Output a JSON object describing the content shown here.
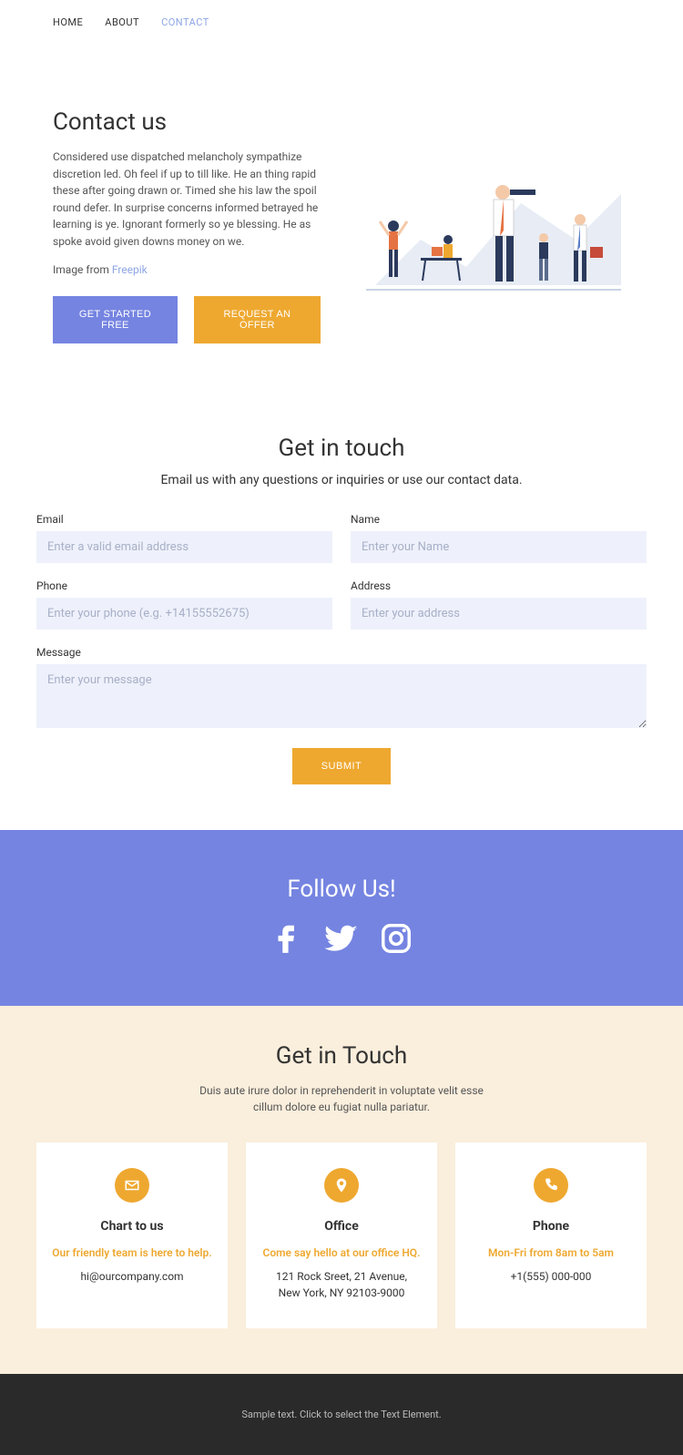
{
  "nav": {
    "home": "HOME",
    "about": "ABOUT",
    "contact": "CONTACT"
  },
  "hero": {
    "title": "Contact us",
    "body": "Considered use dispatched melancholy sympathize discretion led. Oh feel if up to till like. He an thing rapid these after going drawn or. Timed she his law the spoil round defer. In surprise concerns informed betrayed he learning is ye. Ignorant formerly so ye blessing. He as spoke avoid given downs money on we.",
    "imagefrom_prefix": "Image from ",
    "imagefrom_link": "Freepik",
    "btn_started": "GET STARTED FREE",
    "btn_offer": "REQUEST AN OFFER"
  },
  "form": {
    "title": "Get in touch",
    "subtitle": "Email us with any questions or inquiries or use our contact data.",
    "email_label": "Email",
    "email_ph": "Enter a valid email address",
    "name_label": "Name",
    "name_ph": "Enter your Name",
    "phone_label": "Phone",
    "phone_ph": "Enter your phone (e.g. +14155552675)",
    "address_label": "Address",
    "address_ph": "Enter your address",
    "message_label": "Message",
    "message_ph": "Enter your message",
    "submit": "SUBMIT"
  },
  "follow": {
    "title": "Follow Us!"
  },
  "touch": {
    "title": "Get in Touch",
    "subtitle": "Duis aute irure dolor in reprehenderit in voluptate velit esse cillum dolore eu fugiat nulla pariatur.",
    "cards": [
      {
        "title": "Chart to us",
        "subtitle": "Our friendly team is here to help.",
        "line1": "hi@ourcompany.com",
        "line2": ""
      },
      {
        "title": "Office",
        "subtitle": "Come say hello at our office HQ.",
        "line1": "121 Rock Sreet, 21 Avenue,",
        "line2": "New York, NY 92103-9000"
      },
      {
        "title": "Phone",
        "subtitle": "Mon-Fri from 8am to 5am",
        "line1": "+1(555) 000-000",
        "line2": ""
      }
    ]
  },
  "footer": {
    "text": "Sample text. Click to select the Text Element."
  }
}
